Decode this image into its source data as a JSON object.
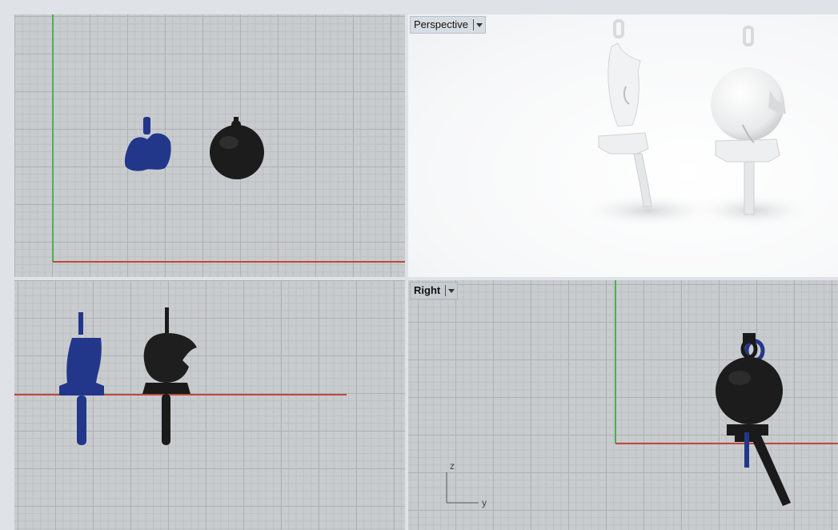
{
  "viewports": {
    "top": {
      "name": ""
    },
    "perspective": {
      "name": "Perspective"
    },
    "front": {
      "name": ""
    },
    "right": {
      "name": "Right"
    }
  },
  "axis_widget": {
    "z": "z",
    "y": "y"
  },
  "colors": {
    "grid_bg": "#c9ccce",
    "x_axis": "#c0473c",
    "y_axis": "#4caf50",
    "object_blue": "#23378a",
    "object_black": "#1a1a1a",
    "render_white": "#f2f2f2"
  }
}
